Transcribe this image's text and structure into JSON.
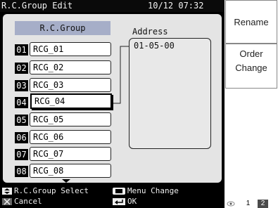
{
  "titlebar": {
    "title": "R.C.Group Edit",
    "datetime": "10/12 07:32"
  },
  "list": {
    "header": "R.C.Group",
    "selected_index": 3,
    "rows": [
      {
        "num": "01",
        "name": "RCG_01"
      },
      {
        "num": "02",
        "name": "RCG_02"
      },
      {
        "num": "03",
        "name": "RCG_03"
      },
      {
        "num": "04",
        "name": "RCG_04"
      },
      {
        "num": "05",
        "name": "RCG_05"
      },
      {
        "num": "06",
        "name": "RCG_06"
      },
      {
        "num": "07",
        "name": "RCG_07"
      },
      {
        "num": "08",
        "name": "RCG_08"
      }
    ]
  },
  "address": {
    "label": "Address",
    "value": "01-05-00"
  },
  "side": {
    "rename": "Rename",
    "order_line1": "Order",
    "order_line2": "Change"
  },
  "footer": {
    "select": "R.C.Group Select",
    "menu_change": "Menu Change",
    "cancel": "Cancel",
    "ok": "OK"
  },
  "pager": {
    "page1": "1",
    "page2": "2",
    "current": 1
  },
  "colors": {
    "list_header_bg": "#a6aec8",
    "panel_bg": "#e4e4e4",
    "screen_bg": "#000000"
  },
  "icons": [
    "up-down-arrows-icon",
    "cancel-x-icon",
    "menu-icon",
    "enter-return-icon",
    "eye-icon",
    "scroll-down-arrow-icon"
  ]
}
